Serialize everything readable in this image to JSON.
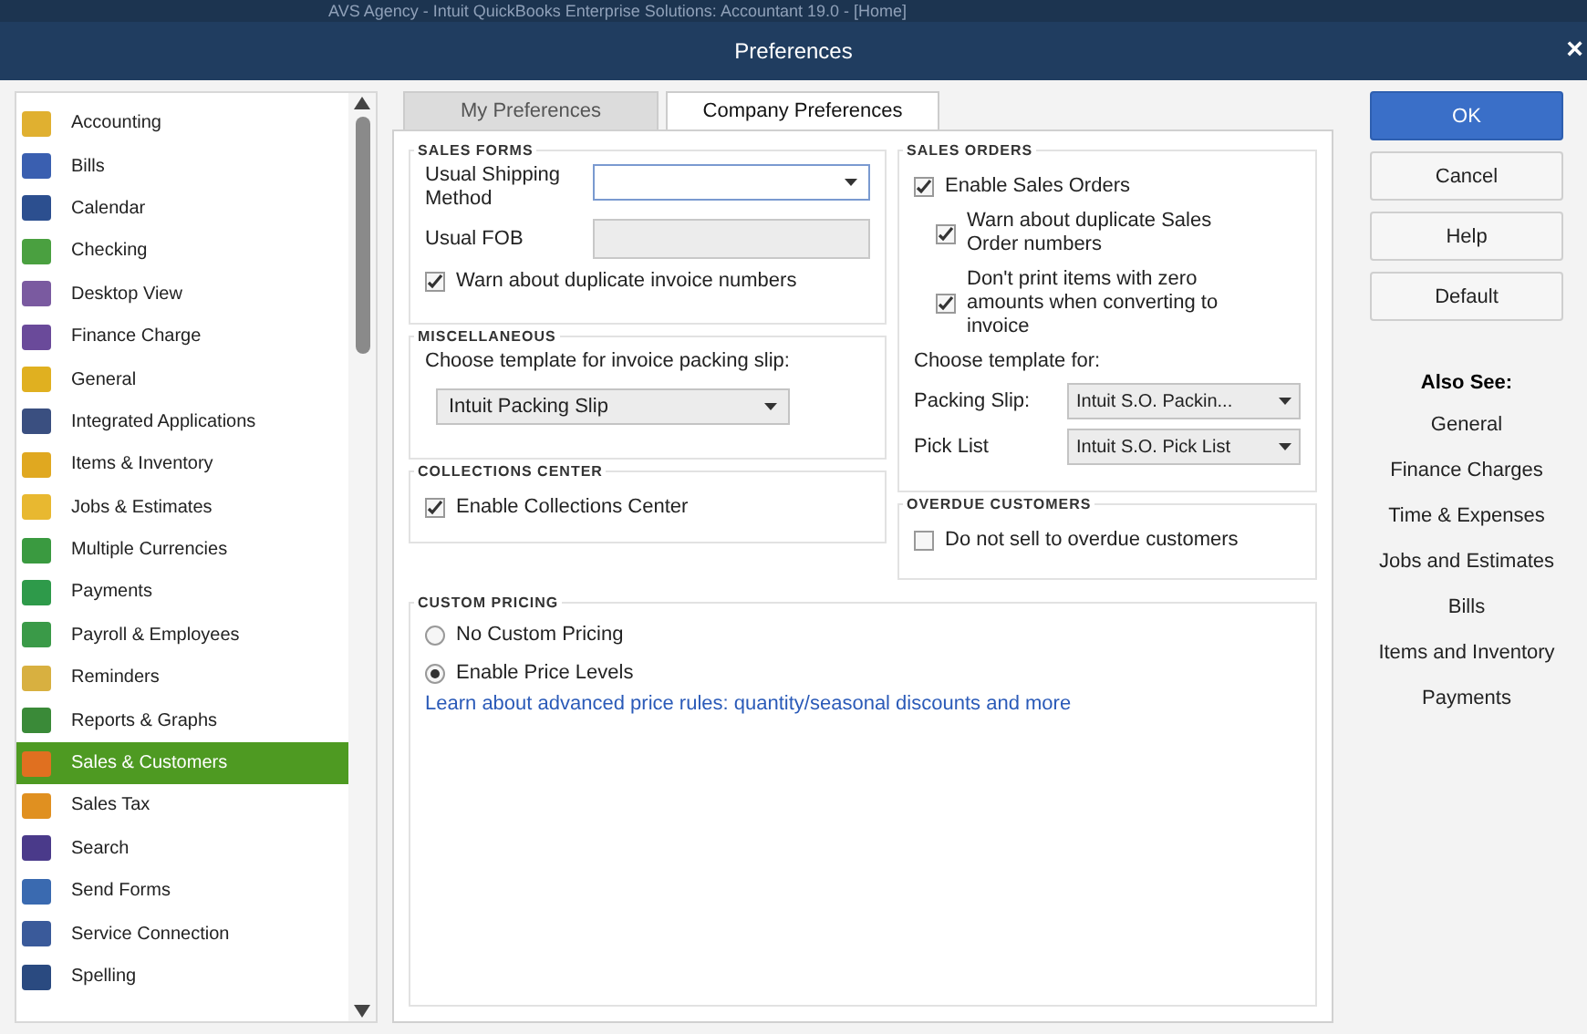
{
  "window": {
    "app_title": "AVS Agency - Intuit QuickBooks Enterprise Solutions: Accountant 19.0 - [Home]",
    "title": "Preferences",
    "close": "×"
  },
  "categories": [
    {
      "label": "Accounting",
      "color": "#e0b030",
      "selected": false
    },
    {
      "label": "Bills",
      "color": "#3a5fb0",
      "selected": false
    },
    {
      "label": "Calendar",
      "color": "#2c4f8f",
      "selected": false
    },
    {
      "label": "Checking",
      "color": "#4aa040",
      "selected": false
    },
    {
      "label": "Desktop View",
      "color": "#7a5aa0",
      "selected": false
    },
    {
      "label": "Finance Charge",
      "color": "#6a4a9a",
      "selected": false
    },
    {
      "label": "General",
      "color": "#e0b020",
      "selected": false
    },
    {
      "label": "Integrated Applications",
      "color": "#3a4f80",
      "selected": false
    },
    {
      "label": "Items & Inventory",
      "color": "#e0a820",
      "selected": false
    },
    {
      "label": "Jobs & Estimates",
      "color": "#e8b830",
      "selected": false
    },
    {
      "label": "Multiple Currencies",
      "color": "#3a9a40",
      "selected": false
    },
    {
      "label": "Payments",
      "color": "#2e9a4a",
      "selected": false
    },
    {
      "label": "Payroll & Employees",
      "color": "#3a9a48",
      "selected": false
    },
    {
      "label": "Reminders",
      "color": "#d8b040",
      "selected": false
    },
    {
      "label": "Reports & Graphs",
      "color": "#3a8a38",
      "selected": false
    },
    {
      "label": "Sales & Customers",
      "color": "#e07020",
      "selected": true
    },
    {
      "label": "Sales Tax",
      "color": "#e09020",
      "selected": false
    },
    {
      "label": "Search",
      "color": "#4a3a8a",
      "selected": false
    },
    {
      "label": "Send Forms",
      "color": "#3a6ab0",
      "selected": false
    },
    {
      "label": "Service Connection",
      "color": "#3a5a9a",
      "selected": false
    },
    {
      "label": "Spelling",
      "color": "#2a4a80",
      "selected": false
    }
  ],
  "tabs": [
    {
      "label": "My Preferences",
      "selected": false
    },
    {
      "label": "Company Preferences",
      "selected": true
    }
  ],
  "sales_forms": {
    "heading": "SALES FORMS",
    "shipping_label": "Usual Shipping Method",
    "fob_label": "Usual FOB",
    "fob_disabled": true,
    "warn_duplicate": {
      "label": "Warn about duplicate invoice numbers",
      "checked": true
    }
  },
  "miscellaneous": {
    "heading": "MISCELLANEOUS",
    "prompt": "Choose template for invoice packing slip:",
    "template": "Intuit Packing Slip"
  },
  "collections_center": {
    "heading": "COLLECTIONS CENTER",
    "option": {
      "label": "Enable Collections Center",
      "checked": true
    }
  },
  "sales_orders": {
    "heading": "SALES ORDERS",
    "options": [
      {
        "label": "Enable Sales Orders",
        "checked": true,
        "children": [
          {
            "label": "Warn about duplicate Sales Order numbers",
            "checked": true
          },
          {
            "label": "Don't print items with zero amounts when converting to invoice",
            "checked": true
          }
        ]
      }
    ],
    "template_prompt": "Choose template for:",
    "templates": [
      {
        "label": "Packing Slip:",
        "value": "Intuit S.O. Packin..."
      },
      {
        "label": "Pick List",
        "value": "Intuit S.O. Pick List"
      }
    ]
  },
  "overdue_customers": {
    "heading": "OVERDUE CUSTOMERS",
    "option": {
      "label": "Do not sell to overdue customers",
      "checked": false
    }
  },
  "custom_pricing": {
    "heading": "CUSTOM PRICING",
    "options": [
      {
        "label": "No Custom Pricing",
        "selected": false
      },
      {
        "label": "Enable Price Levels",
        "selected": true
      }
    ],
    "link": "Learn about advanced price rules: quantity/seasonal discounts and more"
  },
  "buttons": [
    {
      "label": "OK",
      "primary": true
    },
    {
      "label": "Cancel",
      "primary": false
    },
    {
      "label": "Help",
      "primary": false
    },
    {
      "label": "Default",
      "primary": false
    }
  ],
  "also_see": {
    "heading": "Also See:",
    "links": [
      "General",
      "Finance Charges",
      "Time & Expenses",
      "Jobs and Estimates",
      "Bills",
      "Items and Inventory",
      "Payments"
    ]
  }
}
